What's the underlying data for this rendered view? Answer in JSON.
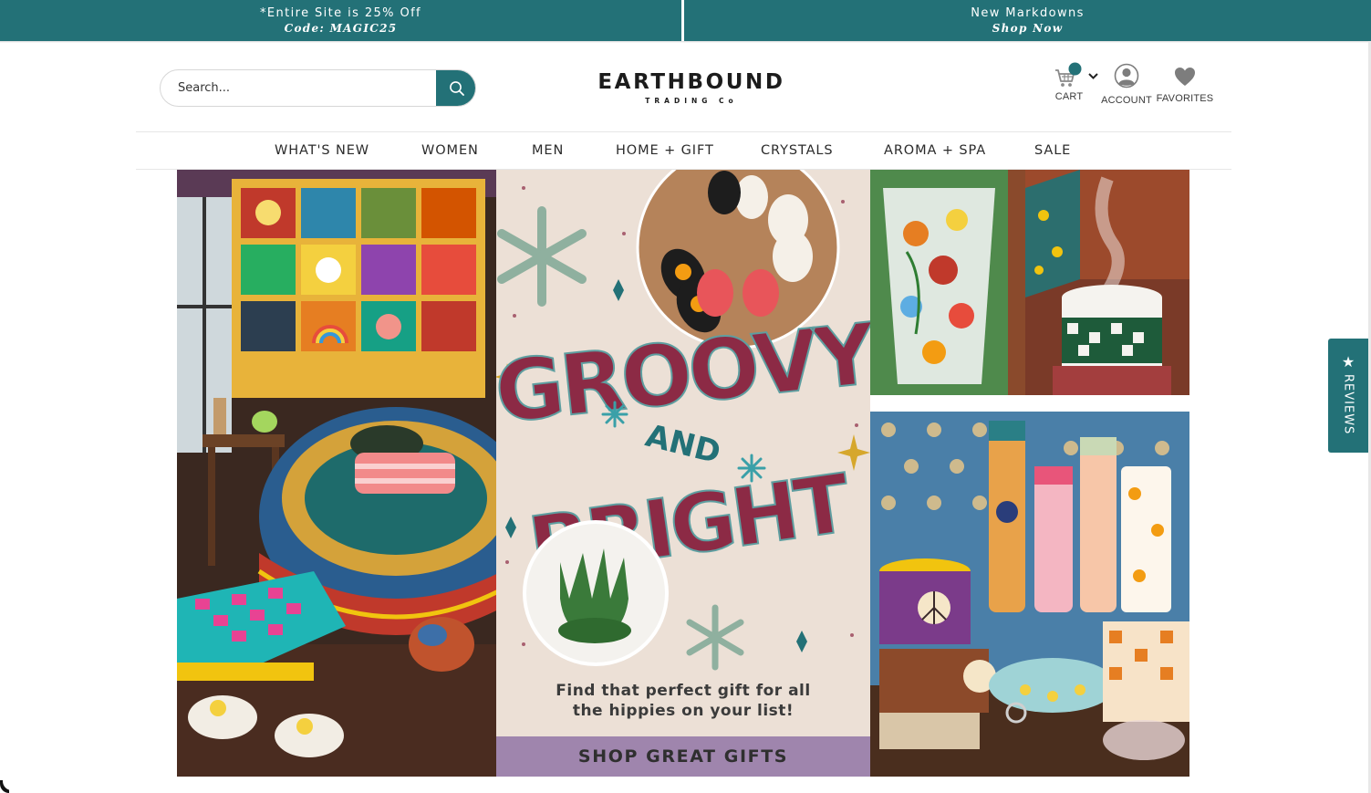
{
  "promo": {
    "left": {
      "line1": "*Entire Site is 25% Off",
      "line2": "Code: MAGIC25"
    },
    "right": {
      "line1": "New Markdowns",
      "line2": "Shop Now"
    },
    "color": "#237177"
  },
  "header": {
    "search": {
      "placeholder": "Search...",
      "icon": "search-icon"
    },
    "logo": {
      "main": "EARTHBOUND",
      "sub": "TRADING Co"
    },
    "cart": {
      "label": "CART",
      "icon": "cart-icon"
    },
    "account": {
      "label": "ACCOUNT",
      "icon": "account-icon"
    },
    "favorites": {
      "label": "FAVORITES",
      "icon": "heart-icon"
    }
  },
  "nav": {
    "items": [
      "WHAT'S NEW",
      "WOMEN",
      "MEN",
      "HOME + GIFT",
      "CRYSTALS",
      "AROMA + SPA",
      "SALE"
    ]
  },
  "hero": {
    "headline_1": "GROOVY",
    "headline_and": "AND",
    "headline_2": "BRIGHT",
    "tagline_1": "Find that perfect gift for all",
    "tagline_2": "the hippies on your list!",
    "cta": "SHOP GREAT GIFTS",
    "cta_color": "#9f85ad",
    "headline_color": "#8c2a45"
  },
  "reviews_tab": {
    "label": "REVIEWS",
    "icon": "star-icon"
  }
}
